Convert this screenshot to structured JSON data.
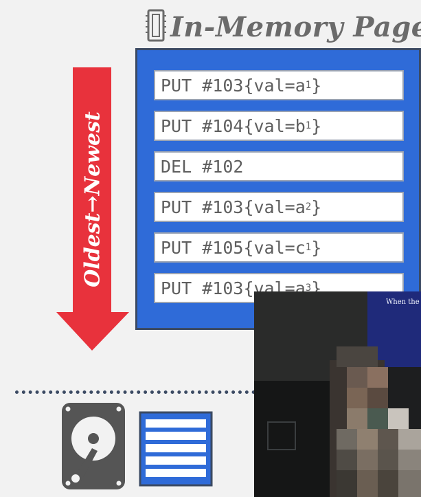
{
  "title": {
    "text": "In-Memory Page",
    "icon": "memory-chip-icon"
  },
  "arrow": {
    "label": "Oldest→Newest",
    "color": "#e8323c"
  },
  "entries": [
    {
      "op": "PUT",
      "key": "#103",
      "open": " {val=",
      "val": "a",
      "sub": "1",
      "close": "}"
    },
    {
      "op": "PUT",
      "key": "#104",
      "open": " {val=",
      "val": "b",
      "sub": "1",
      "close": "}"
    },
    {
      "op": "DEL",
      "key": "#102",
      "open": "",
      "val": "",
      "sub": "",
      "close": ""
    },
    {
      "op": "PUT",
      "key": "#103",
      "open": " {val=",
      "val": "a",
      "sub": "2",
      "close": "}"
    },
    {
      "op": "PUT",
      "key": "#105",
      "open": " {val=",
      "val": "c",
      "sub": "1",
      "close": "}"
    },
    {
      "op": "PUT",
      "key": "#103",
      "open": " {val=",
      "val": "a",
      "sub": "3",
      "close": "}"
    }
  ],
  "disk": {
    "icon": "hard-drive-icon",
    "page_icon": "disk-page-icon"
  },
  "video_overlay": {
    "slide_text": "When the p write th"
  },
  "colors": {
    "page_blue": "#2f6bd8",
    "arrow_red": "#e8323c",
    "entry_text": "#5e5e5e",
    "title_gray": "#6b6b6b"
  }
}
